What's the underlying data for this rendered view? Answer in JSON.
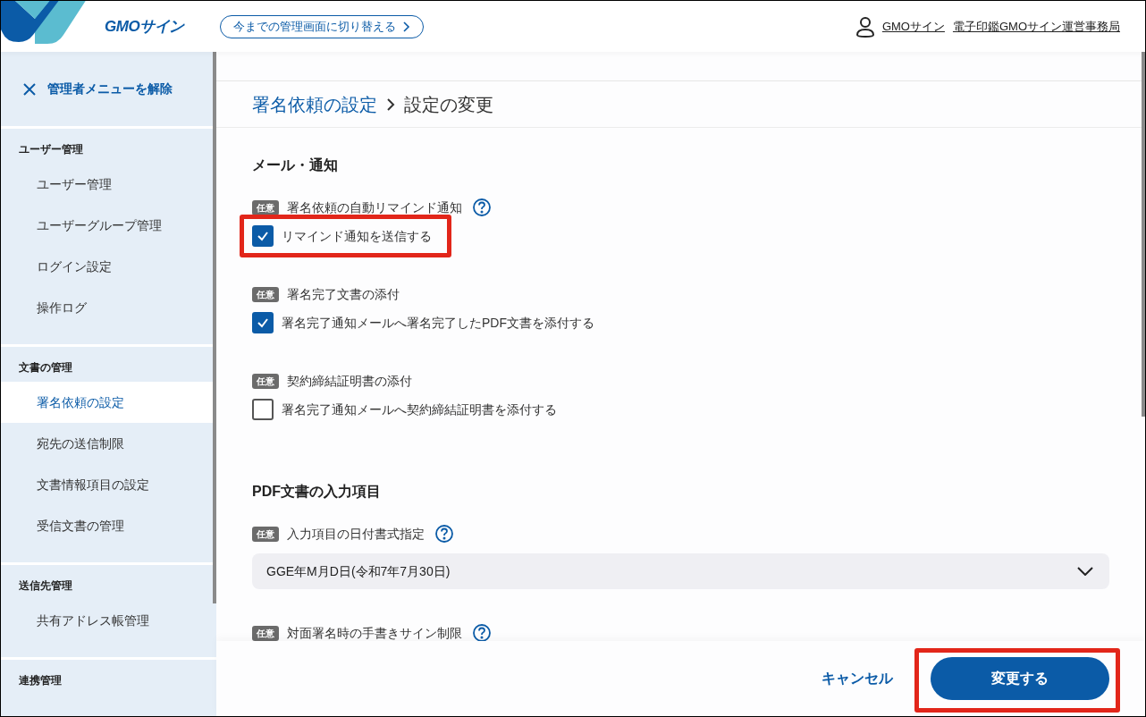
{
  "header": {
    "logo_text": "GMOサイン",
    "switch_link": "今までの管理画面に切り替える",
    "user_links": [
      "GMOサイン",
      "電子印鑑GMOサイン運営事務局"
    ]
  },
  "sidebar": {
    "close_label": "管理者メニューを解除",
    "sections": [
      {
        "title": "ユーザー管理",
        "items": [
          {
            "label": "ユーザー管理",
            "selected": false
          },
          {
            "label": "ユーザーグループ管理",
            "selected": false
          },
          {
            "label": "ログイン設定",
            "selected": false
          },
          {
            "label": "操作ログ",
            "selected": false
          }
        ]
      },
      {
        "title": "文書の管理",
        "items": [
          {
            "label": "署名依頼の設定",
            "selected": true
          },
          {
            "label": "宛先の送信制限",
            "selected": false
          },
          {
            "label": "文書情報項目の設定",
            "selected": false
          },
          {
            "label": "受信文書の管理",
            "selected": false
          }
        ]
      },
      {
        "title": "送信先管理",
        "items": [
          {
            "label": "共有アドレス帳管理",
            "selected": false
          }
        ]
      },
      {
        "title": "連携管理"
      }
    ]
  },
  "breadcrumb": [
    {
      "label": "署名依頼の設定",
      "kind": "link"
    },
    {
      "label": "設定の変更",
      "kind": "current"
    }
  ],
  "sections": [
    {
      "title": "メール・通知",
      "fields": [
        {
          "badge": "任意",
          "label": "署名依頼の自動リマインド通知",
          "help": true,
          "kind": "checkbox",
          "option": "リマインド通知を送信する",
          "checked": true,
          "highlighted": true
        },
        {
          "badge": "任意",
          "label": "署名完了文書の添付",
          "help": false,
          "kind": "checkbox",
          "option": "署名完了通知メールへ署名完了したPDF文書を添付する",
          "checked": true,
          "highlighted": false
        },
        {
          "badge": "任意",
          "label": "契約締結証明書の添付",
          "help": false,
          "kind": "checkbox",
          "option": "署名完了通知メールへ契約締結証明書を添付する",
          "checked": false,
          "highlighted": false
        }
      ]
    },
    {
      "title": "PDF文書の入力項目",
      "fields": [
        {
          "badge": "任意",
          "label": "入力項目の日付書式指定",
          "help": true,
          "kind": "select",
          "value": "GGE年M月D日(令和7年7月30日)"
        },
        {
          "badge": "任意",
          "label": "対面署名時の手書きサイン制限",
          "help": true,
          "kind": "label"
        }
      ]
    }
  ],
  "footer": {
    "cancel": "キャンセル",
    "submit": "変更する",
    "submit_highlighted": true
  }
}
